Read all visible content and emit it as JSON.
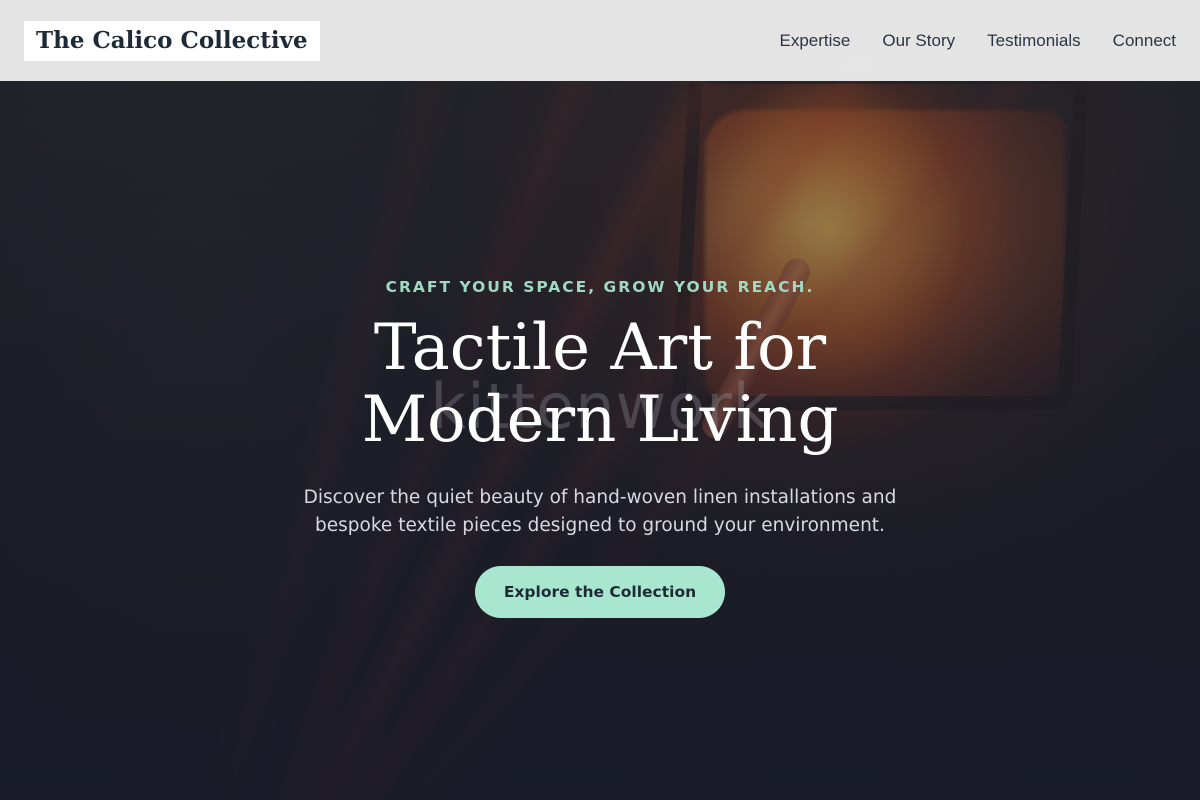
{
  "header": {
    "logo_text": "The Calico Collective",
    "nav": [
      {
        "label": "Expertise"
      },
      {
        "label": "Our Story"
      },
      {
        "label": "Testimonials"
      },
      {
        "label": "Connect"
      }
    ]
  },
  "hero": {
    "eyebrow": "CRAFT YOUR SPACE, GROW YOUR REACH.",
    "title": "Tactile Art for Modern Living",
    "watermark": "kittenwork",
    "subtitle": "Discover the quiet beauty of hand-woven linen installations and bespoke textile pieces designed to ground your environment.",
    "cta_label": "Explore the Collection"
  },
  "colors": {
    "accent": "#a8e6cf",
    "eyebrow": "#9fd9c2",
    "header_bg": "#ececec",
    "text_dark": "#1f2a37"
  }
}
